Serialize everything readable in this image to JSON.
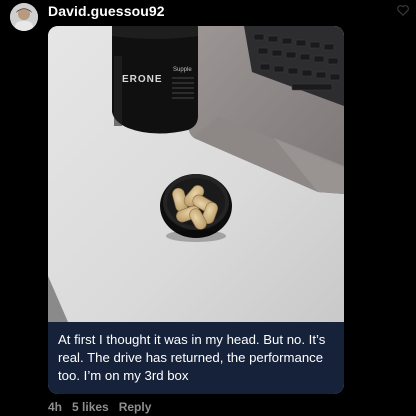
{
  "post": {
    "username": "David.guessou92",
    "caption": "At first I thought it was in my head. But no. It’s real. The drive has returned, the performance too. I’m on my 3rd box",
    "time": "4h",
    "likes": "5 likes",
    "reply_label": "Reply"
  },
  "photo": {
    "bottle_label": "ERONE",
    "bottle_side_text": "Supple"
  },
  "icons": {
    "like": "heart-outline-icon",
    "avatar": "user-avatar"
  },
  "colors": {
    "background": "#000000",
    "caption_bg": "#16213a",
    "meta_text": "#8e8e8e"
  }
}
